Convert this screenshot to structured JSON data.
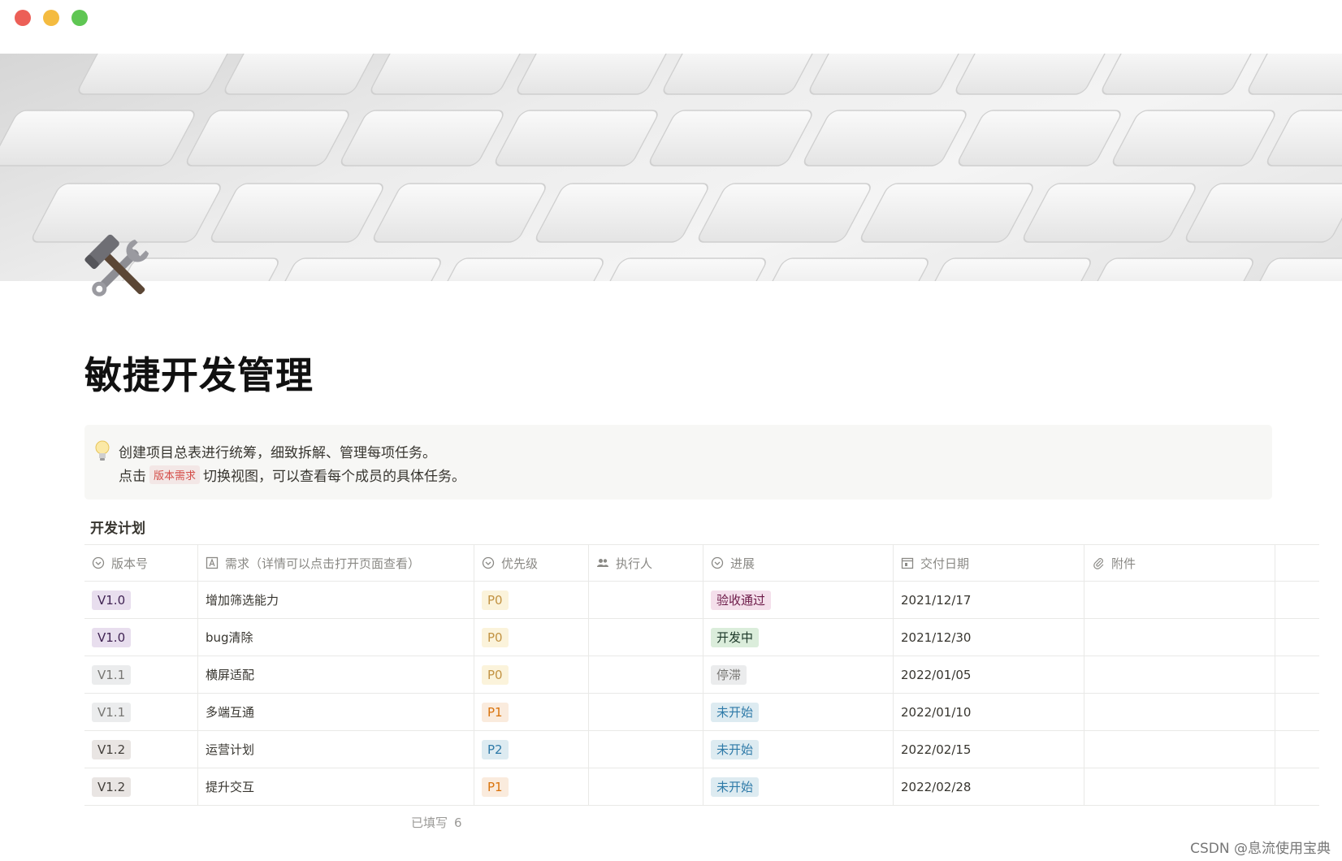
{
  "window": {
    "controls": [
      "close",
      "minimize",
      "maximize"
    ]
  },
  "page": {
    "icon": "hammer-and-wrench-icon",
    "title": "敏捷开发管理"
  },
  "callout": {
    "icon": "lightbulb-icon",
    "line1": "创建项目总表进行统筹，细致拆解、管理每项任务。",
    "line2_prefix": "点击",
    "line2_tag": "版本需求",
    "line2_suffix": "切换视图，可以查看每个成员的具体任务。"
  },
  "database": {
    "title": "开发计划",
    "columns": [
      {
        "label": "版本号",
        "icon": "select-icon"
      },
      {
        "label": "需求（详情可以点击打开页面查看）",
        "icon": "title-icon"
      },
      {
        "label": "优先级",
        "icon": "select-icon"
      },
      {
        "label": "执行人",
        "icon": "people-icon"
      },
      {
        "label": "进展",
        "icon": "select-icon"
      },
      {
        "label": "交付日期",
        "icon": "calendar-icon"
      },
      {
        "label": "附件",
        "icon": "paperclip-icon"
      }
    ],
    "rows": [
      {
        "version": "V1.0",
        "requirement": "增加筛选能力",
        "priority": "P0",
        "assignee": "",
        "progress": "验收通过",
        "date": "2021/12/17",
        "attachment": ""
      },
      {
        "version": "V1.0",
        "requirement": "bug清除",
        "priority": "P0",
        "assignee": "",
        "progress": "开发中",
        "date": "2021/12/30",
        "attachment": ""
      },
      {
        "version": "V1.1",
        "requirement": "横屏适配",
        "priority": "P0",
        "assignee": "",
        "progress": "停滞",
        "date": "2022/01/05",
        "attachment": ""
      },
      {
        "version": "V1.1",
        "requirement": "多端互通",
        "priority": "P1",
        "assignee": "",
        "progress": "未开始",
        "date": "2022/01/10",
        "attachment": ""
      },
      {
        "version": "V1.2",
        "requirement": "运营计划",
        "priority": "P2",
        "assignee": "",
        "progress": "未开始",
        "date": "2022/02/15",
        "attachment": ""
      },
      {
        "version": "V1.2",
        "requirement": "提升交互",
        "priority": "P1",
        "assignee": "",
        "progress": "未开始",
        "date": "2022/02/28",
        "attachment": ""
      }
    ],
    "footer_label": "已填写",
    "footer_count": "6"
  },
  "tag_colors": {
    "V1.0": {
      "bg": "#e8deee",
      "fg": "#412454"
    },
    "V1.1": {
      "bg": "#ebeced",
      "fg": "#787774"
    },
    "V1.2": {
      "bg": "#e9e5e3",
      "fg": "#44403c"
    },
    "P0": {
      "bg": "#fbf3db",
      "fg": "#c29343"
    },
    "P1": {
      "bg": "#faebdd",
      "fg": "#d9730d"
    },
    "P2": {
      "bg": "#ddebf1",
      "fg": "#2e7aa8"
    },
    "验收通过": {
      "bg": "#f4dfeb",
      "fg": "#6c1a48"
    },
    "开发中": {
      "bg": "#dbeddb",
      "fg": "#1c3829"
    },
    "停滞": {
      "bg": "#ebeced",
      "fg": "#787774"
    },
    "未开始": {
      "bg": "#ddebf1",
      "fg": "#2e7aa8"
    }
  },
  "watermark": "CSDN @息流使用宝典"
}
